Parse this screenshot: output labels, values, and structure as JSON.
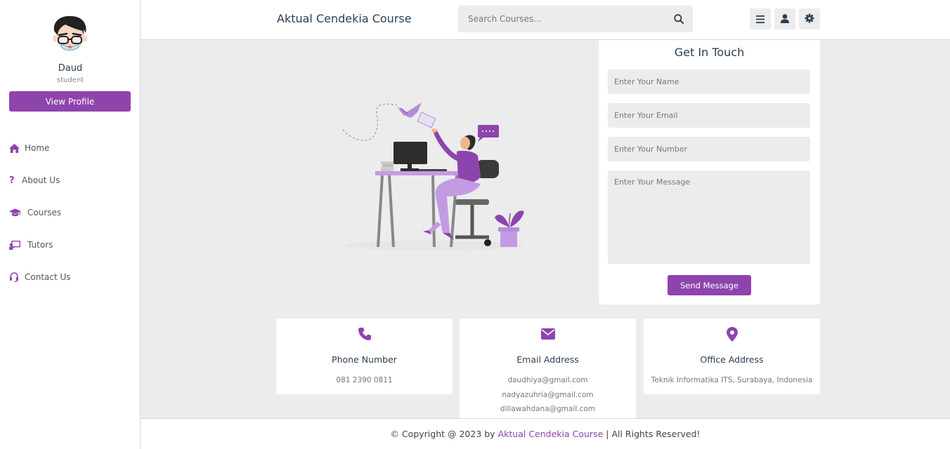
{
  "app": {
    "title": "Aktual Cendekia Course",
    "accent_color": "#8e44ad"
  },
  "header": {
    "brand": "Aktual Cendekia Course",
    "search_placeholder": "Search Courses...",
    "search_icon": "search-icon",
    "buttons": [
      {
        "icon": "menu-icon"
      },
      {
        "icon": "user-icon"
      },
      {
        "icon": "gear-icon"
      }
    ]
  },
  "sidebar": {
    "user": {
      "name": "Daud",
      "role": "student",
      "avatar_icon": "avatar-icon"
    },
    "view_profile_label": "View Profile",
    "items": [
      {
        "label": "Home",
        "icon": "home-icon"
      },
      {
        "label": "About Us",
        "icon": "question-icon"
      },
      {
        "label": "Courses",
        "icon": "graduation-cap-icon"
      },
      {
        "label": "Tutors",
        "icon": "chalkboard-teacher-icon"
      },
      {
        "label": "Contact Us",
        "icon": "headset-icon"
      }
    ]
  },
  "contact_form": {
    "title": "Get In Touch",
    "name_placeholder": "Enter Your Name",
    "email_placeholder": "Enter Your Email",
    "number_placeholder": "Enter Your Number",
    "message_placeholder": "Enter Your Message",
    "send_label": "Send Message"
  },
  "info_cards": [
    {
      "title": "Phone Number",
      "icon": "phone-icon",
      "values": [
        "081 2390 0811"
      ]
    },
    {
      "title": "Email Address",
      "icon": "envelope-icon",
      "values": [
        "daudhiya@gmail.com",
        "nadyazuhria@gmail.com",
        "dillawahdana@gmail.com"
      ]
    },
    {
      "title": "Office Address",
      "icon": "map-marker-icon",
      "values": [
        "Teknik Informatika ITS, Surabaya, Indonesia"
      ]
    }
  ],
  "footer": {
    "prefix": "© Copyright @ 2023 by",
    "brand": "Aktual Cendekia Course",
    "suffix": "| All Rights Reserved!"
  }
}
